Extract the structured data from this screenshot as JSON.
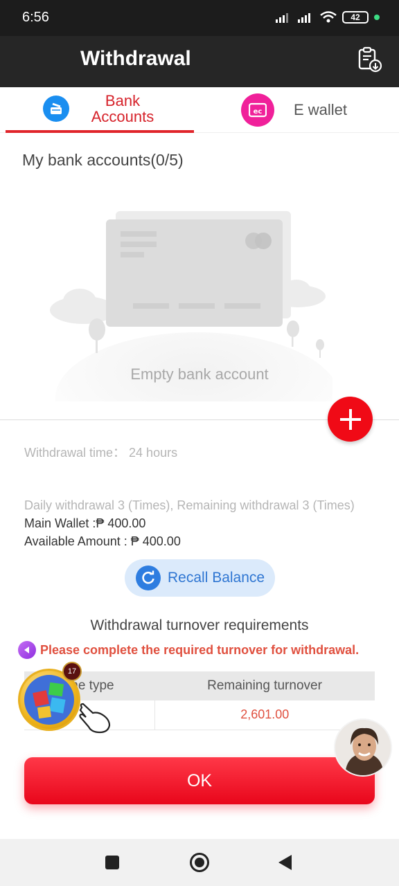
{
  "status_bar": {
    "time": "6:56",
    "battery": "42"
  },
  "header": {
    "title": "Withdrawal",
    "right_icon": "clipboard-download-icon"
  },
  "tabs": [
    {
      "label_line1": "Bank",
      "label_line2": "Accounts",
      "icon": "bank-card-icon",
      "active": true
    },
    {
      "label": "E wallet",
      "icon": "e-wallet-icon",
      "active": false
    }
  ],
  "bank_section": {
    "title": "My bank accounts(0/5)",
    "empty_text": "Empty bank account"
  },
  "info": {
    "withdrawal_time": "Withdrawal time： 24 hours",
    "daily_withdrawal": "Daily withdrawal 3 (Times), Remaining withdrawal 3 (Times)",
    "main_wallet": "Main Wallet :₱ 400.00",
    "available_amount": "Available Amount : ₱ 400.00"
  },
  "recall_button": {
    "label": "Recall Balance"
  },
  "turnover": {
    "title": "Withdrawal turnover requirements",
    "warning": "Please complete the required turnover for withdrawal.",
    "columns": [
      "me type",
      "Remaining turnover"
    ],
    "rows": [
      {
        "game_type": "",
        "remaining": "2,601.00"
      }
    ]
  },
  "ok_button": {
    "label": "OK"
  },
  "game_widget": {
    "badge": "17"
  },
  "colors": {
    "accent_red": "#e0252b",
    "header_bg": "#262626",
    "recall_blue": "#2e7de0"
  }
}
